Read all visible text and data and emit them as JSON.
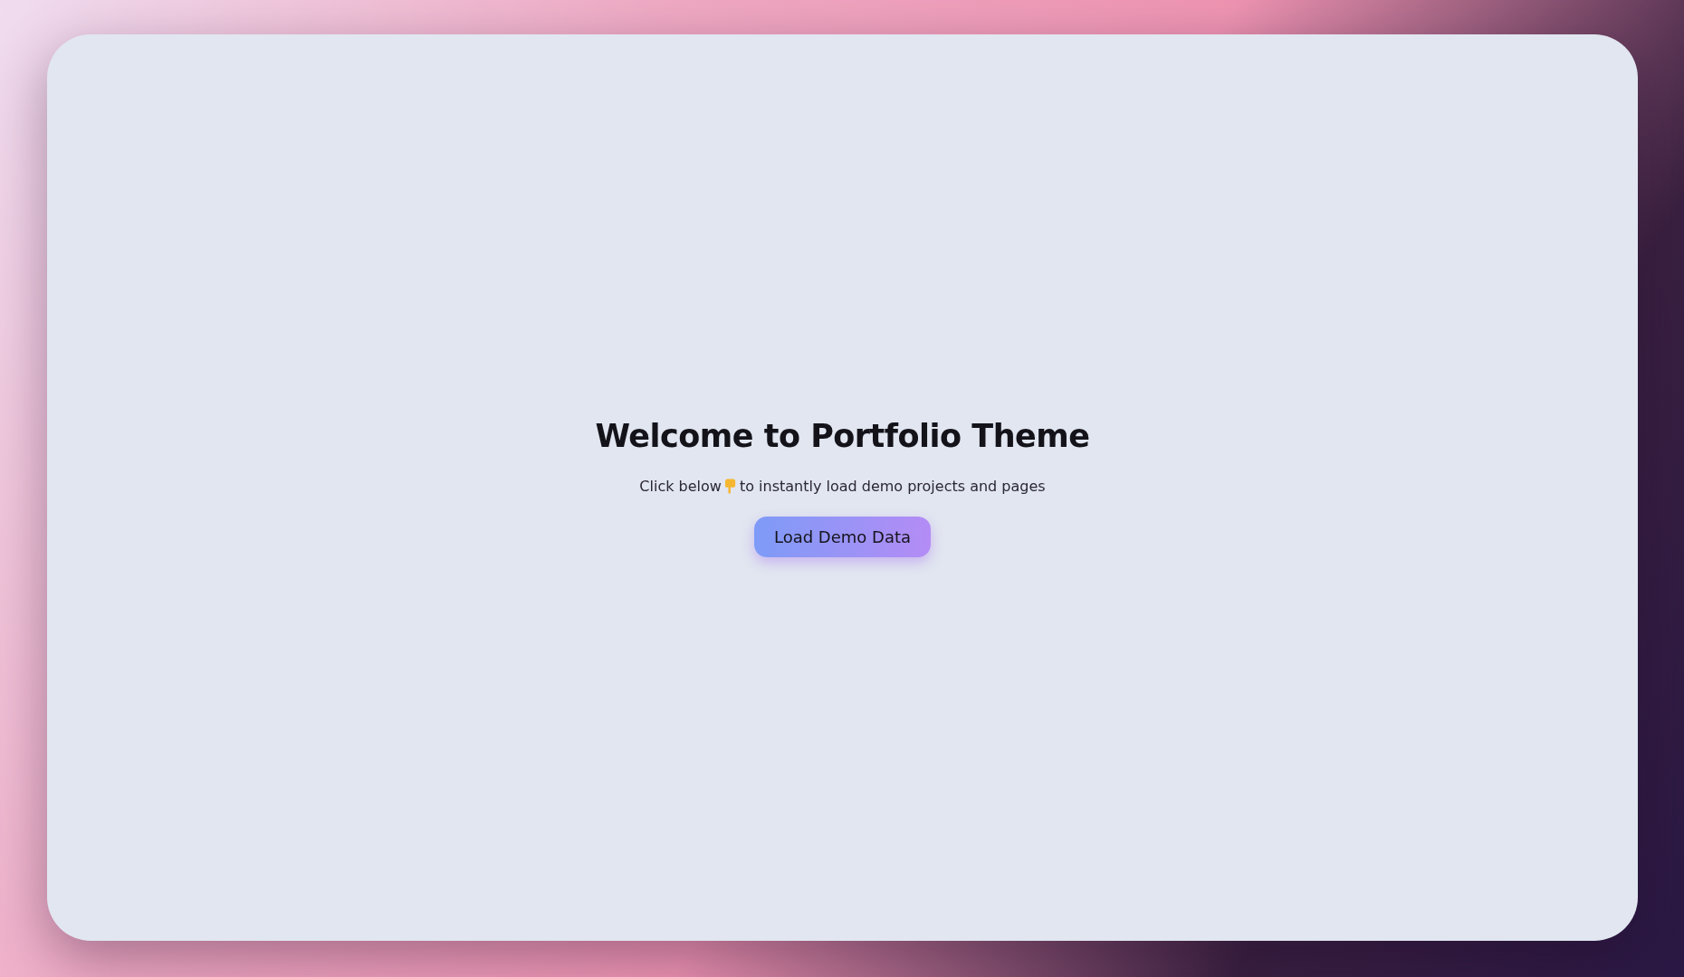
{
  "heading": "Welcome to Portfolio Theme",
  "subtitle": {
    "before": "Click below",
    "after": "to instantly load demo projects and pages"
  },
  "button": {
    "label": "Load Demo Data"
  }
}
